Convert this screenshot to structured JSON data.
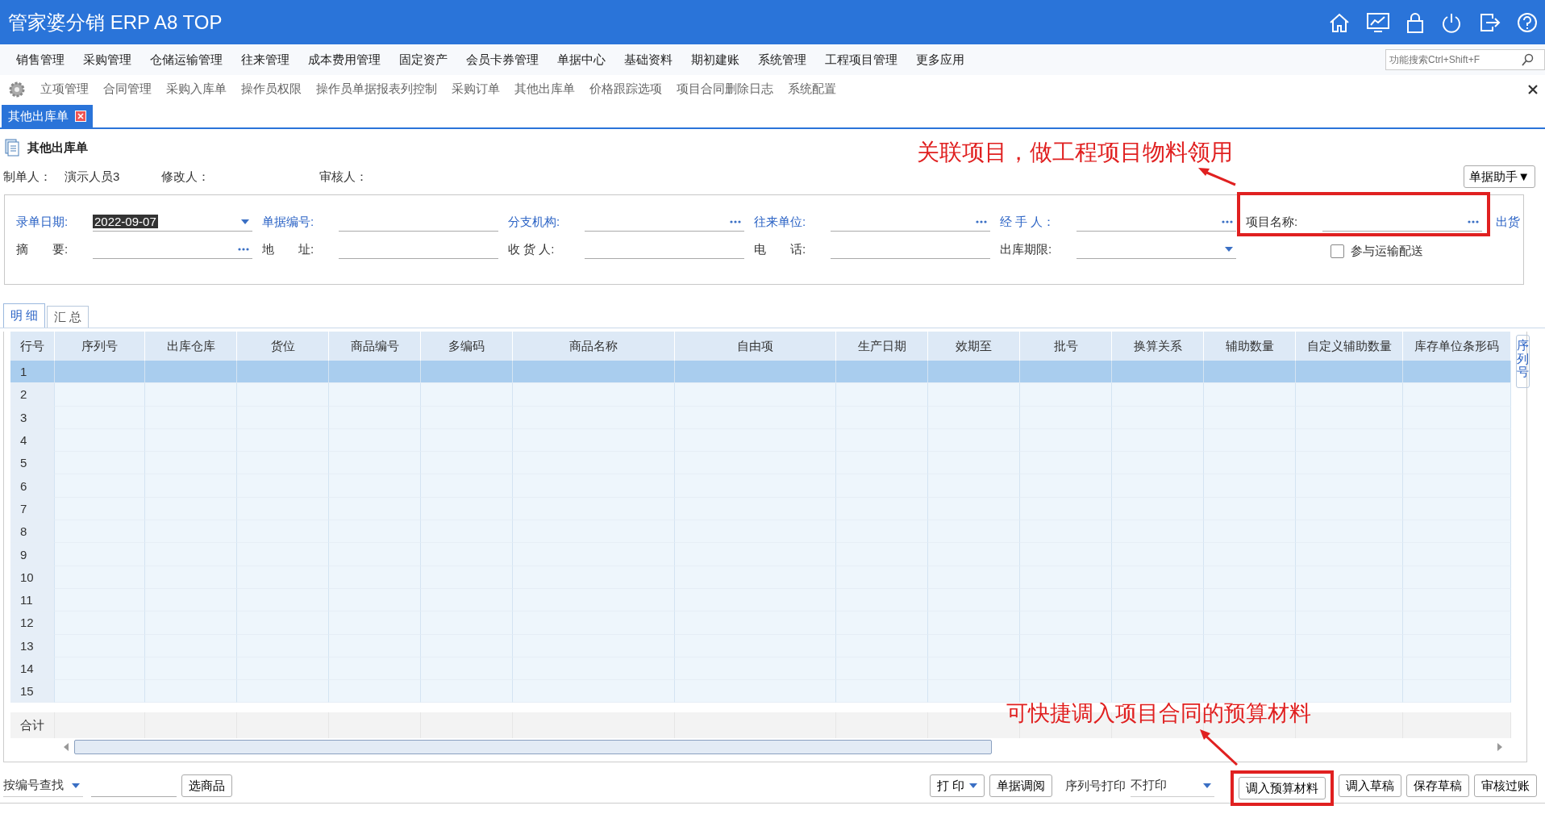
{
  "app_title": "管家婆分销 ERP A8 TOP",
  "menu": [
    "销售管理",
    "采购管理",
    "仓储运输管理",
    "往来管理",
    "成本费用管理",
    "固定资产",
    "会员卡券管理",
    "单据中心",
    "基础资料",
    "期初建账",
    "系统管理",
    "工程项目管理",
    "更多应用"
  ],
  "search": {
    "placeholder": "功能搜索Ctrl+Shift+F"
  },
  "shortcuts": [
    "立项管理",
    "合同管理",
    "采购入库单",
    "操作员权限",
    "操作员单据报表列控制",
    "采购订单",
    "其他出库单",
    "价格跟踪选项",
    "项目合同删除日志",
    "系统配置"
  ],
  "doc_tabs": [
    {
      "label": "其他出库单",
      "selected": true
    }
  ],
  "form_title": "其他出库单",
  "meta": [
    {
      "label": "制单人：",
      "value": "演示人员3"
    },
    {
      "label": "修改人："
    },
    {
      "label": "审核人："
    }
  ],
  "helper_button": "单据助手▼",
  "field_rows": [
    [
      {
        "label": "录单日期:",
        "link": true,
        "kind": "select",
        "value": "2022-09-07"
      },
      {
        "label": "单据编号:",
        "link": true,
        "kind": "text"
      },
      {
        "label": "分支机构:",
        "link": true,
        "kind": "lookup"
      },
      {
        "label": "往来单位:",
        "link": true,
        "kind": "lookup"
      },
      {
        "label": "经 手 人：",
        "link": true,
        "kind": "lookup"
      },
      {
        "label": "项目名称:",
        "link": false,
        "kind": "lookup"
      }
    ],
    [
      {
        "label": "摘　　要:",
        "link": false,
        "kind": "lookup"
      },
      {
        "label": "地　　址:",
        "link": false,
        "kind": "text"
      },
      {
        "label": "收 货 人:",
        "link": false,
        "kind": "text"
      },
      {
        "label": "电　　话:",
        "link": false,
        "kind": "text"
      },
      {
        "label": "出库期限:",
        "link": false,
        "kind": "select"
      }
    ]
  ],
  "ship_link": "出货",
  "transport_checkbox": {
    "label": "参与运输配送",
    "checked": false
  },
  "detail_tabs": [
    {
      "label": "明 细",
      "selected": true
    },
    {
      "label": "汇 总",
      "selected": false
    }
  ],
  "table": {
    "columns": [
      "行号",
      "序列号",
      "出库仓库",
      "货位",
      "商品编号",
      "多编码",
      "商品名称",
      "自由项",
      "生产日期",
      "效期至",
      "批号",
      "换算关系",
      "辅助数量",
      "自定义辅助数量",
      "库存单位条形码"
    ],
    "rows": [
      {
        "no": "1",
        "selected": true
      },
      {
        "no": "2",
        "selected": false
      },
      {
        "no": "3",
        "selected": false
      },
      {
        "no": "4",
        "selected": false
      },
      {
        "no": "5",
        "selected": false
      },
      {
        "no": "6",
        "selected": false
      },
      {
        "no": "7",
        "selected": false
      },
      {
        "no": "8",
        "selected": false
      },
      {
        "no": "9",
        "selected": false
      },
      {
        "no": "10",
        "selected": false
      },
      {
        "no": "11",
        "selected": false
      },
      {
        "no": "12",
        "selected": false
      },
      {
        "no": "13",
        "selected": false
      },
      {
        "no": "14",
        "selected": false
      },
      {
        "no": "15",
        "selected": false
      }
    ],
    "total_label": "合计"
  },
  "side_tab": "序列号",
  "bottom": {
    "find_select": "按编号查找",
    "pick_button": "选商品",
    "print_button": "打 印",
    "review_button": "单据调阅",
    "serial_print_label": "序列号打印",
    "serial_print_select": "不打印",
    "actions": [
      "调入预算材料",
      "调入草稿",
      "保存草稿",
      "审核过账"
    ]
  },
  "annotations": [
    {
      "text": "关联项目，做工程项目物料领用"
    },
    {
      "text": "可快捷调入项目合同的预算材料"
    }
  ]
}
